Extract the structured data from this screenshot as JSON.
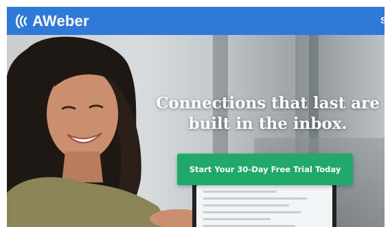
{
  "header": {
    "brand": "AWeber",
    "logo_icon": "aweber-waves-icon",
    "edge_glyph": "S",
    "colors": {
      "bar": "#2f7ad8",
      "logo": "#ffffff"
    }
  },
  "hero": {
    "headline_line1": "Connections that last are",
    "headline_line2": "built in the inbox.",
    "cta_label": "Start Your 30-Day Free Trial Today",
    "colors": {
      "cta": "#1ea86a",
      "headline": "#ffffff"
    }
  }
}
